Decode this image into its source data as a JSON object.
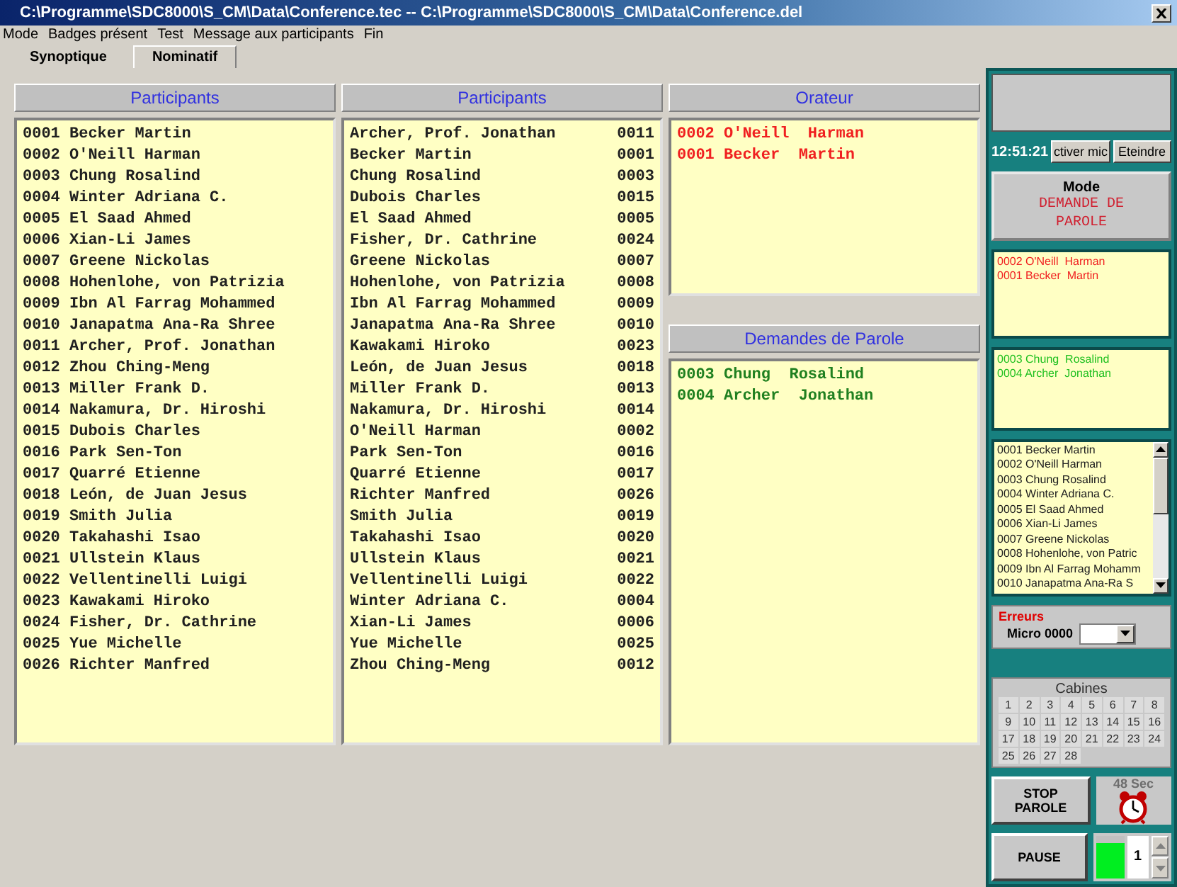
{
  "window": {
    "title": "C:\\Programme\\SDC8000\\S_CM\\Data\\Conference.tec -- C:\\Programme\\SDC8000\\S_CM\\Data\\Conference.del"
  },
  "menu": [
    "Mode",
    "Badges présent",
    "Test",
    "Message aux participants",
    "Fin"
  ],
  "tabs": [
    {
      "label": "Synoptique",
      "selected": false
    },
    {
      "label": "Nominatif",
      "selected": true
    }
  ],
  "participants_by_id": {
    "title": "Participants",
    "rows": [
      "0001 Becker Martin",
      "0002 O'Neill Harman",
      "0003 Chung Rosalind",
      "0004 Winter Adriana C.",
      "0005 El Saad Ahmed",
      "0006 Xian-Li James",
      "0007 Greene Nickolas",
      "0008 Hohenlohe, von Patrizia",
      "0009 Ibn Al Farrag Mohammed",
      "0010 Janapatma Ana-Ra Shree",
      "0011 Archer, Prof. Jonathan",
      "0012 Zhou Ching-Meng",
      "0013 Miller Frank D.",
      "0014 Nakamura, Dr. Hiroshi",
      "0015 Dubois Charles",
      "0016 Park Sen-Ton",
      "0017 Quarré Etienne",
      "0018 León, de Juan Jesus",
      "0019 Smith Julia",
      "0020 Takahashi Isao",
      "0021 Ullstein Klaus",
      "0022 Vellentinelli Luigi",
      "0023 Kawakami Hiroko",
      "0024 Fisher, Dr. Cathrine",
      "0025 Yue Michelle",
      "0026 Richter Manfred"
    ]
  },
  "participants_by_name": {
    "title": "Participants",
    "rows": [
      {
        "name": "Archer, Prof. Jonathan",
        "id": "0011"
      },
      {
        "name": "Becker Martin",
        "id": "0001"
      },
      {
        "name": "Chung Rosalind",
        "id": "0003"
      },
      {
        "name": "Dubois Charles",
        "id": "0015"
      },
      {
        "name": "El Saad Ahmed",
        "id": "0005"
      },
      {
        "name": "Fisher, Dr. Cathrine",
        "id": "0024"
      },
      {
        "name": "Greene Nickolas",
        "id": "0007"
      },
      {
        "name": "Hohenlohe, von Patrizia",
        "id": "0008"
      },
      {
        "name": "Ibn Al Farrag Mohammed",
        "id": "0009"
      },
      {
        "name": "Janapatma Ana-Ra Shree",
        "id": "0010"
      },
      {
        "name": "Kawakami Hiroko",
        "id": "0023"
      },
      {
        "name": "León, de Juan Jesus",
        "id": "0018"
      },
      {
        "name": "Miller Frank D.",
        "id": "0013"
      },
      {
        "name": "Nakamura, Dr. Hiroshi",
        "id": "0014"
      },
      {
        "name": "O'Neill Harman",
        "id": "0002"
      },
      {
        "name": "Park Sen-Ton",
        "id": "0016"
      },
      {
        "name": "Quarré Etienne",
        "id": "0017"
      },
      {
        "name": "Richter Manfred",
        "id": "0026"
      },
      {
        "name": "Smith Julia",
        "id": "0019"
      },
      {
        "name": "Takahashi Isao",
        "id": "0020"
      },
      {
        "name": "Ullstein Klaus",
        "id": "0021"
      },
      {
        "name": "Vellentinelli Luigi",
        "id": "0022"
      },
      {
        "name": "Winter Adriana C.",
        "id": "0004"
      },
      {
        "name": "Xian-Li James",
        "id": "0006"
      },
      {
        "name": "Yue Michelle",
        "id": "0025"
      },
      {
        "name": "Zhou Ching-Meng",
        "id": "0012"
      }
    ]
  },
  "speakers": {
    "title": "Orateur",
    "rows": [
      "0002 O'Neill  Harman",
      "0001 Becker  Martin"
    ]
  },
  "requests": {
    "title": "Demandes de Parole",
    "rows": [
      "0003 Chung  Rosalind",
      "0004 Archer  Jonathan"
    ]
  },
  "side": {
    "clock": "12:51:21",
    "buttons": [
      "ctiver mic",
      "Eteindre"
    ],
    "mode_label": "Mode",
    "mode_value": "DEMANDE DE PAROLE",
    "speakers": [
      "0002 O'Neill  Harman",
      "0001 Becker  Martin"
    ],
    "requests": [
      "0003 Chung  Rosalind",
      "0004 Archer  Jonathan"
    ],
    "participants": [
      "0001 Becker Martin",
      "0002 O'Neill Harman",
      "0003 Chung Rosalind",
      "0004 Winter Adriana C.",
      "0005 El Saad Ahmed",
      "0006 Xian-Li James",
      "0007 Greene Nickolas",
      "0008 Hohenlohe, von Patric",
      "0009 Ibn Al Farrag Mohamm",
      "0010 Janapatma Ana-Ra S"
    ],
    "errors_label": "Erreurs",
    "micro_label": "Micro 0000",
    "cabines_title": "Cabines",
    "cabines": [
      "1",
      "2",
      "3",
      "4",
      "5",
      "6",
      "7",
      "8",
      "9",
      "10",
      "11",
      "12",
      "13",
      "14",
      "15",
      "16",
      "17",
      "18",
      "19",
      "20",
      "21",
      "22",
      "23",
      "24",
      "25",
      "26",
      "27",
      "28"
    ],
    "stop_button": "STOP PAROLE",
    "timer": {
      "label": "48 Sec",
      "disabled": true
    },
    "pause_button": "PAUSE",
    "meter": {
      "level": 0.82
    },
    "counter": "1"
  }
}
